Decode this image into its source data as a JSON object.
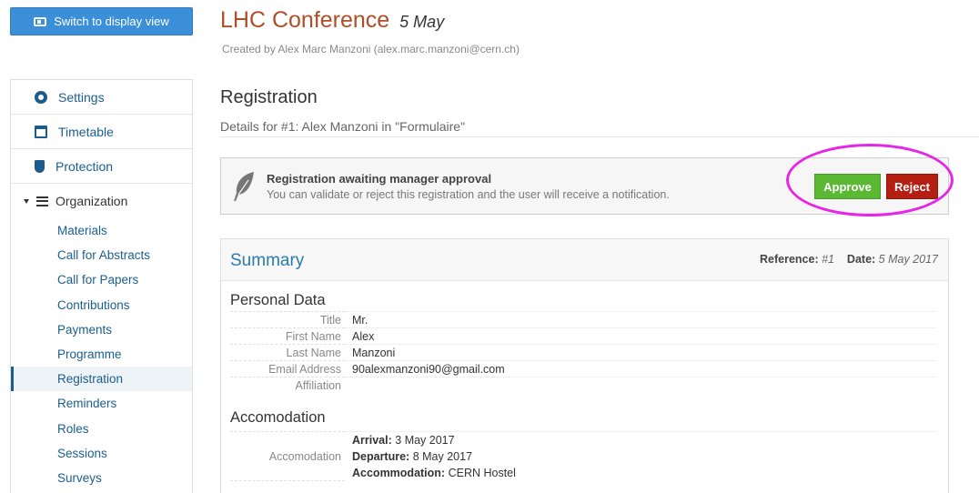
{
  "switch_button": {
    "label": "Switch to display view"
  },
  "sidebar": {
    "top_items": [
      {
        "label": "Settings",
        "icon": "gear-icon"
      },
      {
        "label": "Timetable",
        "icon": "calendar-icon"
      },
      {
        "label": "Protection",
        "icon": "shield-icon"
      }
    ],
    "group": {
      "label": "Organization",
      "icon": "list-icon"
    },
    "sub_items": [
      "Materials",
      "Call for Abstracts",
      "Call for Papers",
      "Contributions",
      "Payments",
      "Programme",
      "Registration",
      "Reminders",
      "Roles",
      "Sessions",
      "Surveys"
    ],
    "active_sub_item": "Registration"
  },
  "event": {
    "title": "LHC Conference",
    "date": "5 May",
    "created_by": "Created by Alex Marc Manzoni (alex.marc.manzoni@cern.ch)"
  },
  "registration": {
    "heading": "Registration",
    "subtitle": "Details for #1: Alex Manzoni in \"Formulaire\""
  },
  "approval": {
    "title": "Registration awaiting manager approval",
    "text": "You can validate or reject this registration and the user will receive a notification.",
    "approve_label": "Approve",
    "reject_label": "Reject",
    "approve_color": "#5ab833",
    "reject_color": "#b51f12",
    "annotation_color": "#e626e6"
  },
  "summary": {
    "title": "Summary",
    "reference_label": "Reference:",
    "reference_value": "#1",
    "date_label": "Date:",
    "date_value": "5 May 2017",
    "personal_section": "Personal Data",
    "personal_fields": [
      {
        "label": "Title",
        "value": "Mr."
      },
      {
        "label": "First Name",
        "value": "Alex"
      },
      {
        "label": "Last Name",
        "value": "Manzoni"
      },
      {
        "label": "Email Address",
        "value": "90alexmanzoni90@gmail.com"
      },
      {
        "label": "Affiliation",
        "value": ""
      }
    ],
    "accommodation_section": "Accomodation",
    "accommodation_label": "Accomodation",
    "accommodation_lines": [
      {
        "key": "Arrival:",
        "value": "3 May 2017"
      },
      {
        "key": "Departure:",
        "value": "8 May 2017"
      },
      {
        "key": "Accommodation:",
        "value": "CERN Hostel"
      }
    ]
  }
}
